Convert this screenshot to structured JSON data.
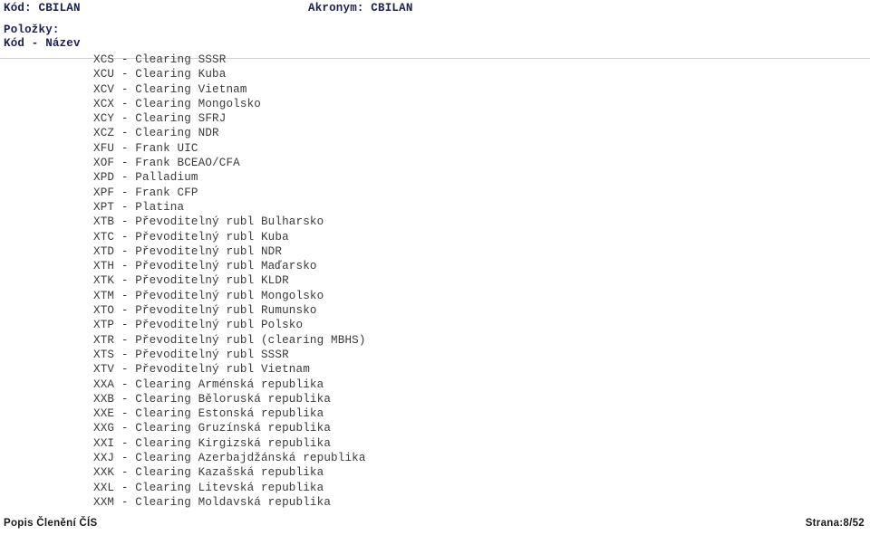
{
  "header": {
    "code_label": "Kód:",
    "code_value": "CBILAN",
    "code_line": "Kód: CBILAN",
    "acronym_label": "Akronym:",
    "acronym_value": "CBILAN",
    "acronym_line": "Akronym: CBILAN",
    "items_label": "Položky:",
    "columns_label": "Kód - Název",
    "text_color": "#1c2050"
  },
  "items": [
    {
      "code": "XCS",
      "name": "Clearing SSSR",
      "line": "XCS - Clearing SSSR"
    },
    {
      "code": "XCU",
      "name": "Clearing Kuba",
      "line": "XCU - Clearing Kuba"
    },
    {
      "code": "XCV",
      "name": "Clearing Vietnam",
      "line": "XCV - Clearing Vietnam"
    },
    {
      "code": "XCX",
      "name": "Clearing Mongolsko",
      "line": "XCX - Clearing Mongolsko"
    },
    {
      "code": "XCY",
      "name": "Clearing SFRJ",
      "line": "XCY - Clearing SFRJ"
    },
    {
      "code": "XCZ",
      "name": "Clearing NDR",
      "line": "XCZ - Clearing NDR"
    },
    {
      "code": "XFU",
      "name": "Frank UIC",
      "line": "XFU - Frank UIC"
    },
    {
      "code": "XOF",
      "name": "Frank BCEAO/CFA",
      "line": "XOF - Frank BCEAO/CFA"
    },
    {
      "code": "XPD",
      "name": "Palladium",
      "line": "XPD - Palladium"
    },
    {
      "code": "XPF",
      "name": "Frank CFP",
      "line": "XPF - Frank CFP"
    },
    {
      "code": "XPT",
      "name": "Platina",
      "line": "XPT - Platina"
    },
    {
      "code": "XTB",
      "name": "Převoditelný rubl Bulharsko",
      "line": "XTB - Převoditelný rubl Bulharsko"
    },
    {
      "code": "XTC",
      "name": "Převoditelný rubl Kuba",
      "line": "XTC - Převoditelný rubl Kuba"
    },
    {
      "code": "XTD",
      "name": "Převoditelný rubl NDR",
      "line": "XTD - Převoditelný rubl NDR"
    },
    {
      "code": "XTH",
      "name": "Převoditelný rubl Maďarsko",
      "line": "XTH - Převoditelný rubl Maďarsko"
    },
    {
      "code": "XTK",
      "name": "Převoditelný rubl KLDR",
      "line": "XTK - Převoditelný rubl KLDR"
    },
    {
      "code": "XTM",
      "name": "Převoditelný rubl Mongolsko",
      "line": "XTM - Převoditelný rubl Mongolsko"
    },
    {
      "code": "XTO",
      "name": "Převoditelný rubl Rumunsko",
      "line": "XTO - Převoditelný rubl Rumunsko"
    },
    {
      "code": "XTP",
      "name": "Převoditelný rubl Polsko",
      "line": "XTP - Převoditelný rubl Polsko"
    },
    {
      "code": "XTR",
      "name": "Převoditelný rubl (clearing MBHS)",
      "line": "XTR - Převoditelný rubl (clearing MBHS)"
    },
    {
      "code": "XTS",
      "name": "Převoditelný rubl SSSR",
      "line": "XTS - Převoditelný rubl SSSR"
    },
    {
      "code": "XTV",
      "name": "Převoditelný rubl Vietnam",
      "line": "XTV - Převoditelný rubl Vietnam"
    },
    {
      "code": "XXA",
      "name": "Clearing Arménská republika",
      "line": "XXA - Clearing Arménská republika"
    },
    {
      "code": "XXB",
      "name": "Clearing Běloruská republika",
      "line": "XXB - Clearing Běloruská republika"
    },
    {
      "code": "XXE",
      "name": "Clearing Estonská republika",
      "line": "XXE - Clearing Estonská republika"
    },
    {
      "code": "XXG",
      "name": "Clearing Gruzínská republika",
      "line": "XXG - Clearing Gruzínská republika"
    },
    {
      "code": "XXI",
      "name": "Clearing Kirgizská republika",
      "line": "XXI - Clearing Kirgizská republika"
    },
    {
      "code": "XXJ",
      "name": "Clearing Azerbajdžánská republika",
      "line": "XXJ - Clearing Azerbajdžánská republika"
    },
    {
      "code": "XXK",
      "name": "Clearing Kazašská republika",
      "line": "XXK - Clearing Kazašská republika"
    },
    {
      "code": "XXL",
      "name": "Clearing Litevská republika",
      "line": "XXL - Clearing Litevská republika"
    },
    {
      "code": "XXM",
      "name": "Clearing Moldavská republika",
      "line": "XXM - Clearing Moldavská republika"
    }
  ],
  "footer": {
    "left": "Popis Členění ČÍS",
    "page_label": "Strana:",
    "page_current": "8",
    "page_total": "52",
    "right": "Strana:8/52"
  }
}
